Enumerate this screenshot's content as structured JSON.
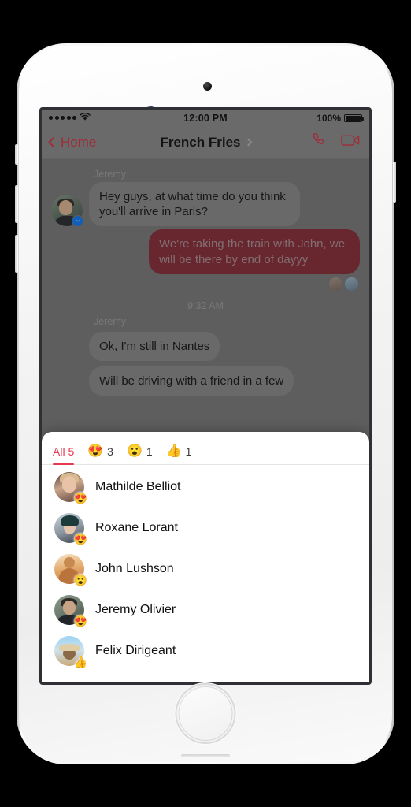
{
  "status_bar": {
    "signal_dots": 5,
    "wifi_icon": "wifi-icon",
    "time": "12:00 PM",
    "battery_percent": "100%"
  },
  "nav": {
    "back_label": "Home",
    "title": "French Fries",
    "disclosure_icon": "chevron-right-icon",
    "call_icon": "phone-icon",
    "video_icon": "video-camera-icon",
    "accent_color": "#a12b38"
  },
  "conversation": {
    "messages": [
      {
        "sender": "Jeremy",
        "text": "Hey guys, at what time do you think you'll arrive in Paris?",
        "side": "in"
      },
      {
        "sender": "",
        "text": "We're taking the train with John, we will be there by end of dayyy",
        "side": "out"
      }
    ],
    "timestamp": "9:32 AM",
    "messages_after": [
      {
        "sender": "Jeremy",
        "text": "Ok, I'm still in Nantes",
        "side": "in"
      },
      {
        "sender": "",
        "text": "Will be driving with a friend in a few",
        "side": "in"
      }
    ],
    "bubble_in_color": "#7b7b7b",
    "bubble_out_color": "#7a2731"
  },
  "reactions_sheet": {
    "tabs": [
      {
        "label": "All 5",
        "emoji": "",
        "count": "",
        "active": true
      },
      {
        "label": "",
        "emoji": "😍",
        "count": "3",
        "active": false
      },
      {
        "label": "",
        "emoji": "😮",
        "count": "1",
        "active": false
      },
      {
        "label": "",
        "emoji": "👍",
        "count": "1",
        "active": false
      }
    ],
    "active_tab_color": "#e8384f",
    "reactors": [
      {
        "name": "Mathilde Belliot",
        "reaction": "😍",
        "avatar_style": "av-a"
      },
      {
        "name": "Roxane Lorant",
        "reaction": "😍",
        "avatar_style": "av-b"
      },
      {
        "name": "John Lushson",
        "reaction": "😮",
        "avatar_style": "av-c"
      },
      {
        "name": "Jeremy Olivier",
        "reaction": "😍",
        "avatar_style": "av-d"
      },
      {
        "name": "Felix Dirigeant",
        "reaction": "👍",
        "avatar_style": "av-e"
      }
    ]
  }
}
